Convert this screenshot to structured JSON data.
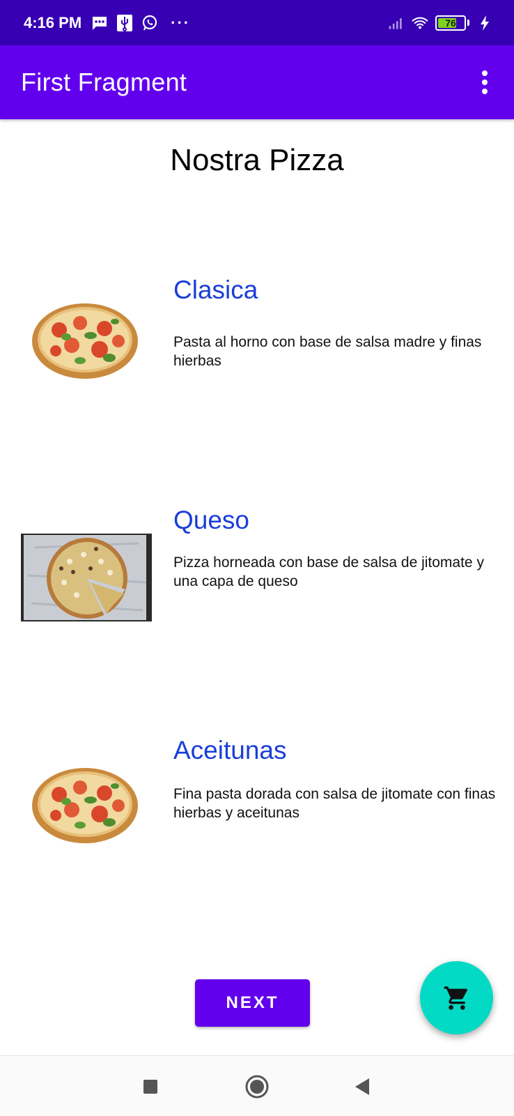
{
  "status_bar": {
    "time": "4:16 PM",
    "left_icons": [
      "message-icon",
      "usb-icon",
      "whatsapp-icon"
    ],
    "more": "···",
    "battery_level": "76",
    "battery_fraction": 0.76,
    "battery_color": "#7ed321",
    "right_icons": [
      "signal-icon",
      "wifi-icon",
      "battery-icon",
      "charging-bolt-icon"
    ]
  },
  "app_bar": {
    "title": "First Fragment",
    "menu_icon": "overflow-menu-icon",
    "color": "#6200ee"
  },
  "main": {
    "heading": "Nostra Pizza",
    "items": [
      {
        "name": "Clasica",
        "description": "Pasta al horno con base de salsa madre y finas hierbas",
        "image": "round-pizza-image"
      },
      {
        "name": "Queso",
        "description": "Pizza horneada con base de salsa de jitomate y una capa de queso",
        "image": "cheese-pizza-image"
      },
      {
        "name": "Aceitunas",
        "description": "Fina pasta dorada con salsa de jitomate con finas hierbas y aceitunas",
        "image": "round-pizza-image"
      }
    ],
    "item_title_color": "#1a3ed8"
  },
  "actions": {
    "next_label": "NEXT",
    "fab_icon": "cart-icon",
    "fab_color": "#03dac5"
  },
  "nav_bar": {
    "icons": [
      "recents-icon",
      "home-icon",
      "back-icon"
    ]
  }
}
